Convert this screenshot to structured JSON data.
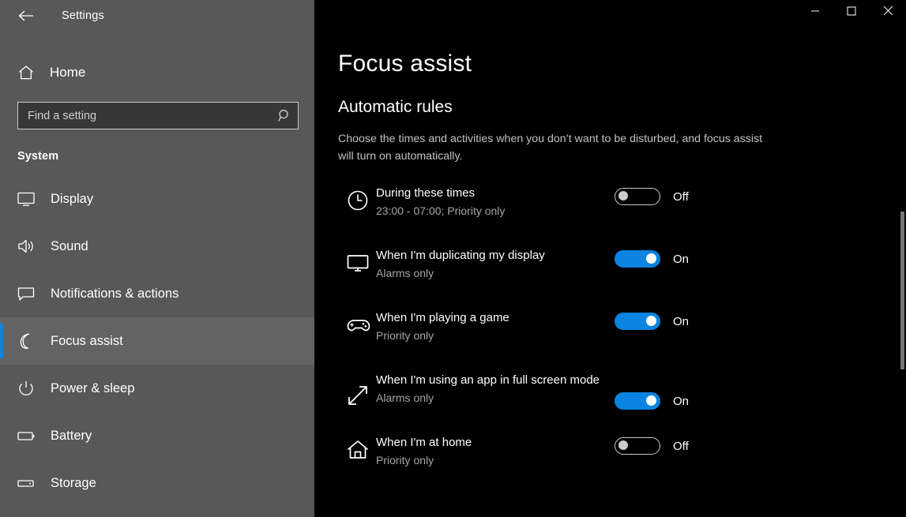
{
  "window": {
    "app_title": "Settings",
    "back_icon": "back-arrow-icon",
    "minimize_label": "—",
    "maximize_label": "□",
    "close_label": "✕"
  },
  "sidebar": {
    "home": {
      "label": "Home",
      "icon": "home-icon"
    },
    "search": {
      "placeholder": "Find a setting",
      "value": "",
      "icon": "search-icon"
    },
    "section_title": "System",
    "items": [
      {
        "label": "Display",
        "icon": "monitor-icon",
        "selected": false
      },
      {
        "label": "Sound",
        "icon": "speaker-icon",
        "selected": false
      },
      {
        "label": "Notifications & actions",
        "icon": "notification-icon",
        "selected": false
      },
      {
        "label": "Focus assist",
        "icon": "moon-icon",
        "selected": true
      },
      {
        "label": "Power & sleep",
        "icon": "power-icon",
        "selected": false
      },
      {
        "label": "Battery",
        "icon": "battery-icon",
        "selected": false
      },
      {
        "label": "Storage",
        "icon": "storage-icon",
        "selected": false
      }
    ]
  },
  "main": {
    "page_title": "Focus assist",
    "rules_heading": "Automatic rules",
    "rules_description": "Choose the times and activities when you don’t want to be disturbed, and focus assist will turn on automatically.",
    "rules": [
      {
        "icon": "clock-icon",
        "title": "During these times",
        "subtitle": "23:00 - 07:00; Priority only",
        "state": "off",
        "state_label": "Off"
      },
      {
        "icon": "monitor-icon",
        "title": "When I'm duplicating my display",
        "subtitle": "Alarms only",
        "state": "on",
        "state_label": "On"
      },
      {
        "icon": "gamepad-icon",
        "title": "When I'm playing a game",
        "subtitle": "Priority only",
        "state": "on",
        "state_label": "On"
      },
      {
        "icon": "fullscreen-arrows-icon",
        "title": "When I'm using an app in full screen mode",
        "subtitle": "Alarms only",
        "state": "on",
        "state_label": "On"
      },
      {
        "icon": "house-icon",
        "title": "When I'm at home",
        "subtitle": "Priority only",
        "state": "off",
        "state_label": "Off"
      }
    ]
  },
  "colors": {
    "accent_blue": "#0a84e0",
    "sidebar_bg": "#585858",
    "main_bg": "#000000",
    "selected_item_bg": "#636363",
    "subtitle_gray": "#a6a6a6"
  }
}
